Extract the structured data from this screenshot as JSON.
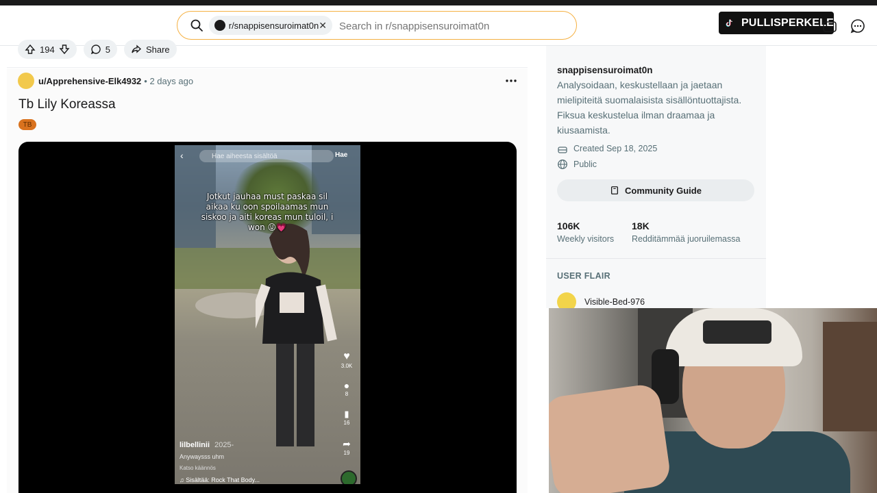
{
  "search": {
    "chip_label": "r/snappisensuroimat0n",
    "placeholder": "Search in r/snappisensuroimat0n",
    "value": ""
  },
  "brand": {
    "name": "PULLISPERKELE"
  },
  "post_actions": {
    "upvotes": "194",
    "comments": "5",
    "share": "Share"
  },
  "post": {
    "author": "u/Apprehensive-Elk4932",
    "time": "• 2 days ago",
    "title": "Tb Lily Koreassa",
    "flair": "TB"
  },
  "video": {
    "search_placeholder": "Hae aiheesta sisältöä",
    "search_button": "Hae",
    "caption": "Jotkut jauhaa must paskaa sil aikaa ku oon spoilaamas mun siskoo ja aiti koreas mun tuloil, i won 😜💗",
    "likes": "3.0K",
    "comments": "8",
    "saves": "16",
    "shares": "19",
    "username": "lilbellinii",
    "year": "2025-",
    "description": "Anywaysss uhm",
    "translate": "Katso käännös",
    "music": "♫ Sisältää: Rock That Body..."
  },
  "sidebar": {
    "name": "snappisensuroimat0n",
    "description": "Analysoidaan, keskustellaan ja jaetaan mielipiteitä suomalaisista sisällöntuottajista. Fiksua keskustelua ilman draamaa ja kiusaamista.",
    "created": "Created Sep 18, 2025",
    "visibility": "Public",
    "guide_button": "Community Guide",
    "stats": [
      {
        "number": "106K",
        "label": "Weekly visitors"
      },
      {
        "number": "18K",
        "label": "Redditämmää juoruilemassa"
      }
    ],
    "user_flair_heading": "USER FLAIR",
    "flair_username": "Visible-Bed-976"
  },
  "colors": {
    "search_border": "#f5b041",
    "flair_bg": "#d9721e",
    "text_muted": "#576f76"
  }
}
